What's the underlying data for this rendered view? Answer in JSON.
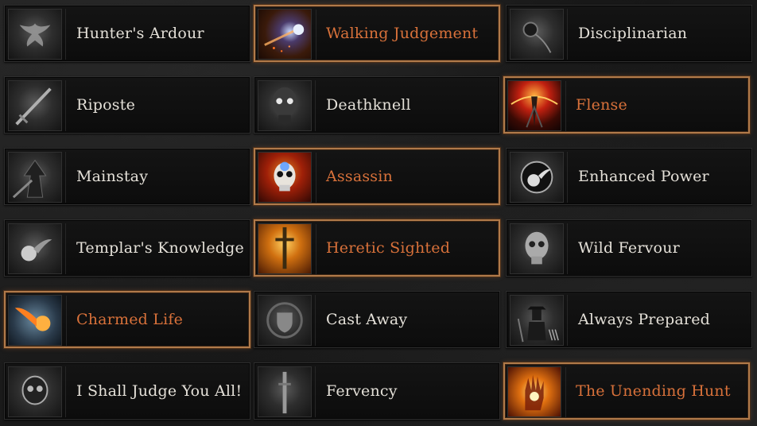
{
  "skills": [
    {
      "label": "Hunter's Ardour",
      "icon": "dove-icon",
      "active": false
    },
    {
      "label": "Walking Judgement",
      "icon": "comet-icon",
      "active": true
    },
    {
      "label": "Disciplinarian",
      "icon": "flail-icon",
      "active": false
    },
    {
      "label": "Riposte",
      "icon": "sword-icon",
      "active": false
    },
    {
      "label": "Deathknell",
      "icon": "skull-icon",
      "active": false
    },
    {
      "label": "Flense",
      "icon": "spire-icon",
      "active": true
    },
    {
      "label": "Mainstay",
      "icon": "hooded-figure-icon",
      "active": false
    },
    {
      "label": "Assassin",
      "icon": "skull-icon",
      "active": true
    },
    {
      "label": "Enhanced Power",
      "icon": "fireball-icon",
      "active": false
    },
    {
      "label": "Templar's Knowledge",
      "icon": "fireball-icon",
      "active": false
    },
    {
      "label": "Heretic Sighted",
      "icon": "sword-icon",
      "active": true
    },
    {
      "label": "Wild Fervour",
      "icon": "skull-icon",
      "active": false
    },
    {
      "label": "Charmed Life",
      "icon": "fireball-icon",
      "active": true
    },
    {
      "label": "Cast Away",
      "icon": "shield-icon",
      "active": false
    },
    {
      "label": "Always Prepared",
      "icon": "hunter-icon",
      "active": false
    },
    {
      "label": "I Shall Judge You All!",
      "icon": "skull-icon",
      "active": false
    },
    {
      "label": "Fervency",
      "icon": "sword-icon",
      "active": false
    },
    {
      "label": "The Unending Hunt",
      "icon": "hand-icon",
      "active": true
    }
  ],
  "colors": {
    "active_text": "#d8713a",
    "inactive_text": "#e4e0d8",
    "active_border": "#b07a4a"
  }
}
